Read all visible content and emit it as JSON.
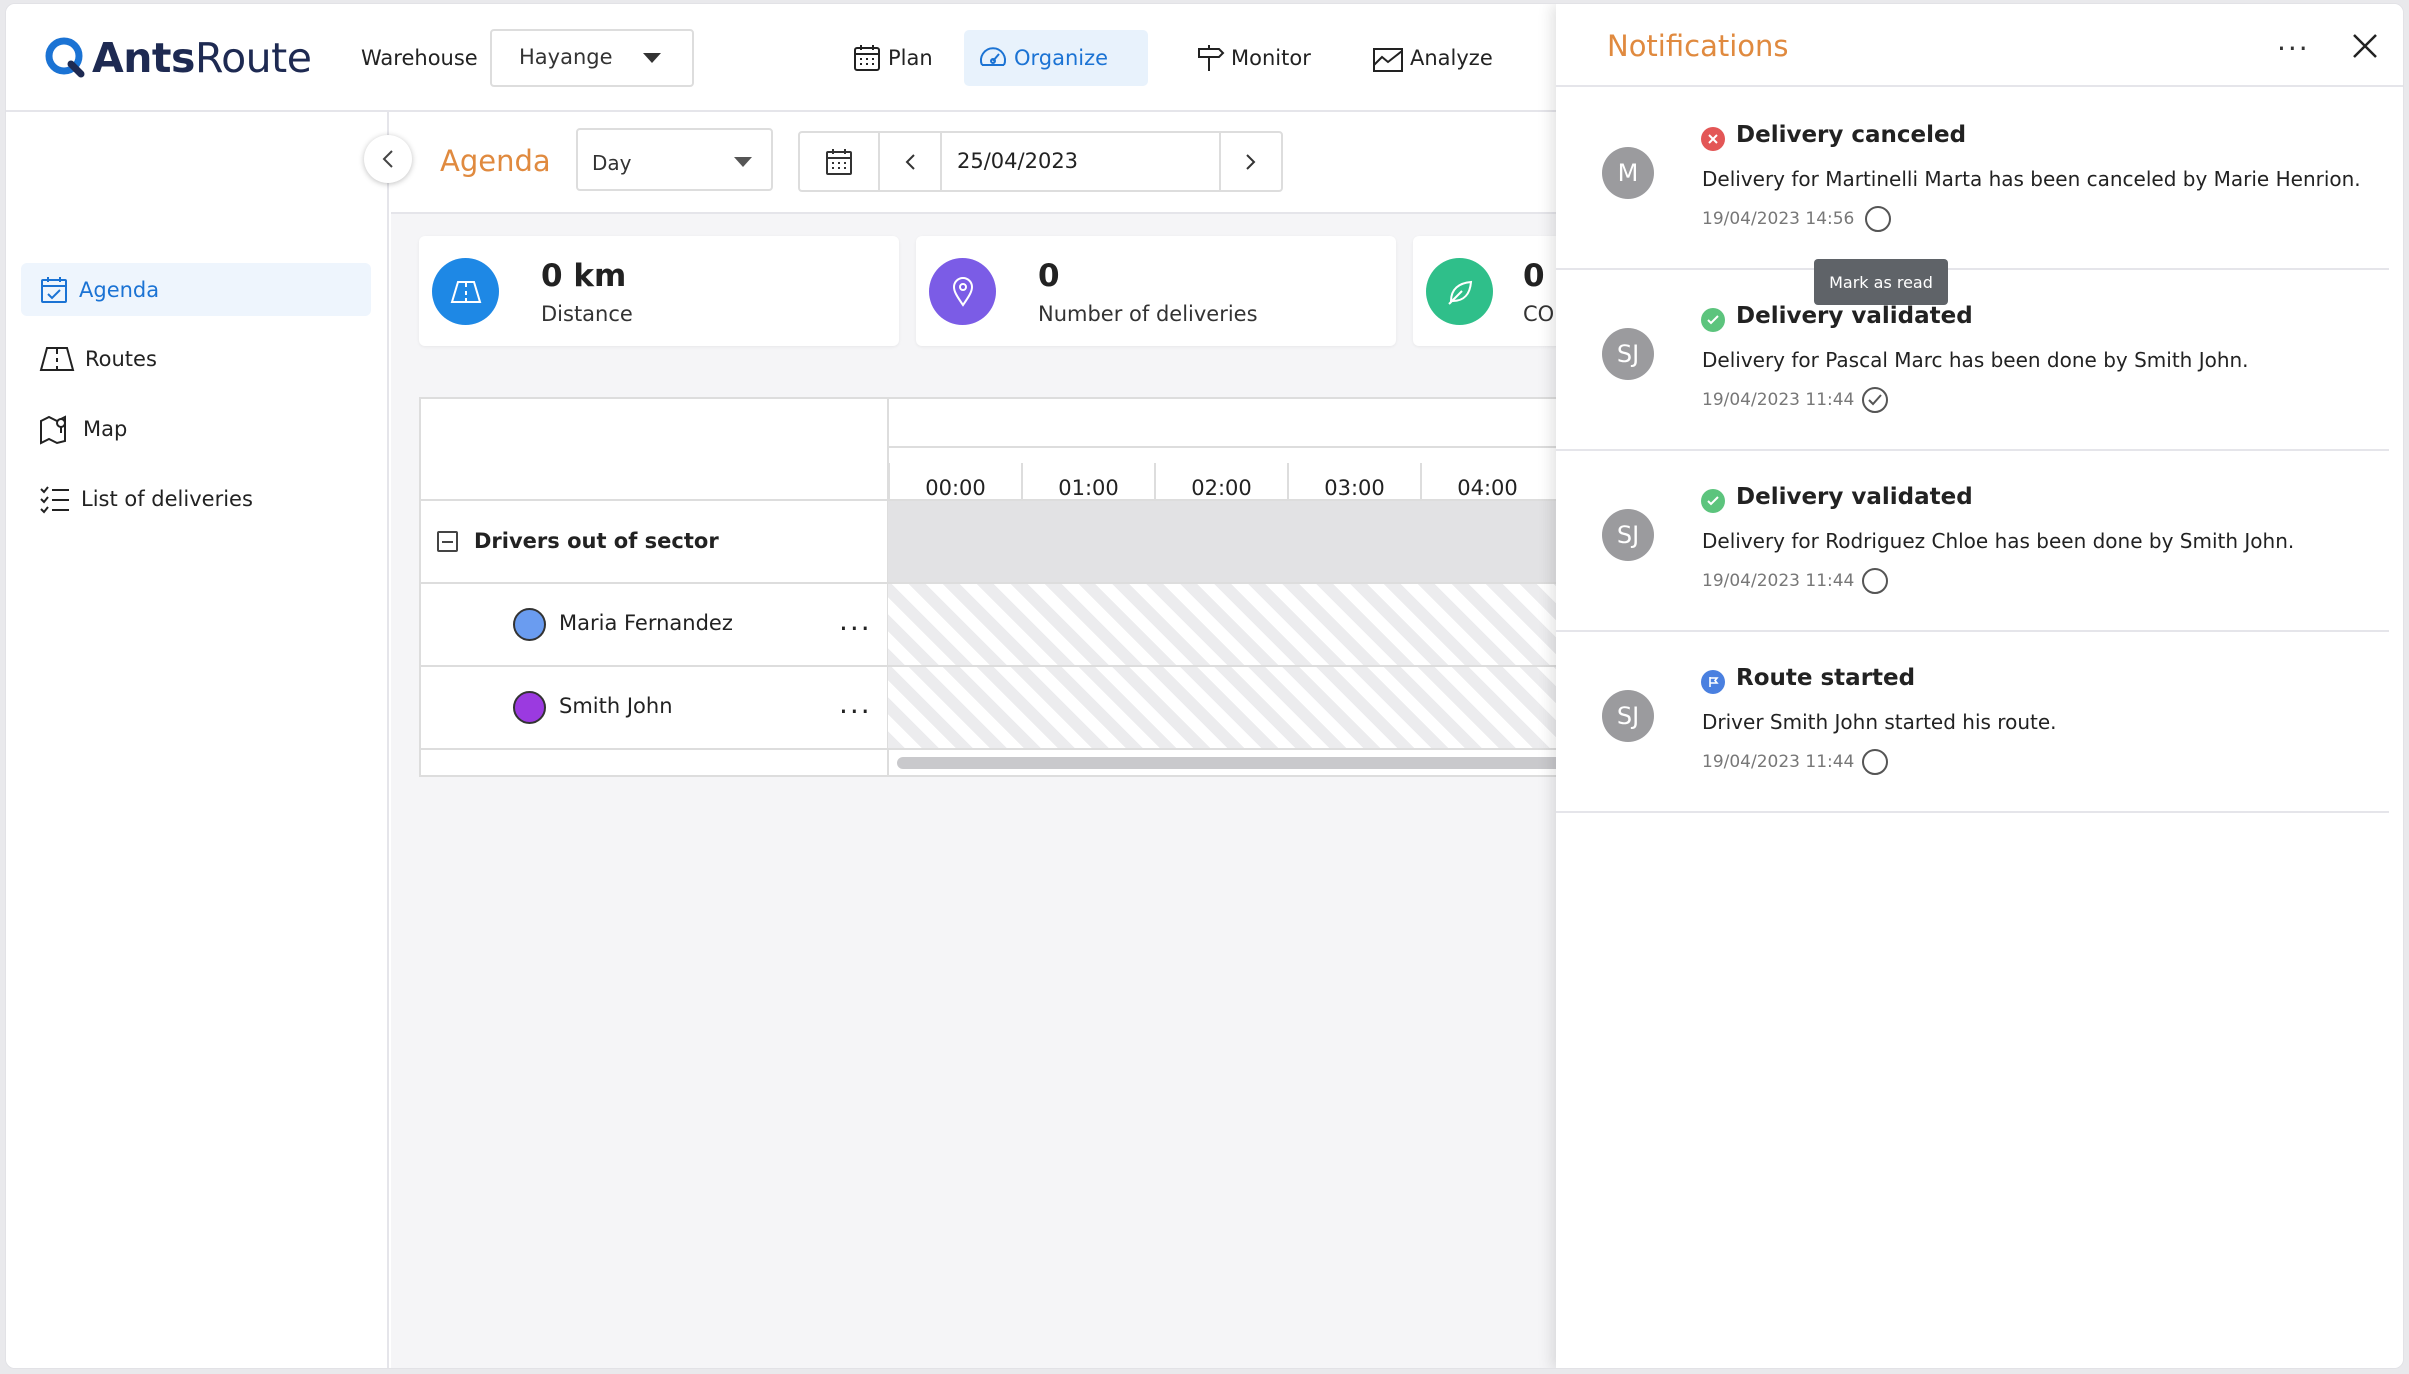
{
  "header": {
    "logo_bold": "Ants",
    "logo_rest": "Route",
    "warehouse_label": "Warehouse",
    "warehouse_value": "Hayange",
    "nav": [
      {
        "label": "Plan",
        "icon": "calendar-grid-icon"
      },
      {
        "label": "Organize",
        "icon": "speedometer-icon"
      },
      {
        "label": "Monitor",
        "icon": "signpost-icon"
      },
      {
        "label": "Analyze",
        "icon": "chart-area-icon"
      }
    ],
    "active_nav": "Organize",
    "accent_color": "#1b73d4"
  },
  "sidebar": {
    "items": [
      {
        "label": "Agenda",
        "icon": "calendar-check-icon",
        "active": true
      },
      {
        "label": "Routes",
        "icon": "map-fold-icon",
        "active": false
      },
      {
        "label": "Map",
        "icon": "map-pin-icon",
        "active": false
      },
      {
        "label": "List of deliveries",
        "icon": "checklist-icon",
        "active": false
      }
    ]
  },
  "agenda": {
    "title": "Agenda",
    "view": "Day",
    "date": "25/04/2023"
  },
  "stats": [
    {
      "value": "0 km",
      "label": "Distance",
      "icon": "road-icon",
      "color": "#1e88e5"
    },
    {
      "value": "0",
      "label": "Number of deliveries",
      "icon": "location-pin-icon",
      "color": "#7b5ce6"
    },
    {
      "value": "0",
      "label": "CO",
      "icon": "leaf-icon",
      "color": "#2fbf8a"
    }
  ],
  "schedule": {
    "hours": [
      "00:00",
      "01:00",
      "02:00",
      "03:00",
      "04:00"
    ],
    "group_label": "Drivers out of sector",
    "drivers": [
      {
        "name": "Maria Fernandez",
        "color": "#6a9cf0",
        "more": "..."
      },
      {
        "name": "Smith John",
        "color": "#9b3ae0",
        "more": "..."
      }
    ]
  },
  "notifications": {
    "title": "Notifications",
    "more": "...",
    "tooltip": "Mark as read",
    "items": [
      {
        "avatar": "M",
        "status": "canceled",
        "title": "Delivery canceled",
        "message": "Delivery for Martinelli Marta has been canceled by Marie Henrion.",
        "time": "19/04/2023 14:56",
        "read": false
      },
      {
        "avatar": "SJ",
        "status": "validated",
        "title": "Delivery validated",
        "message": "Delivery for Pascal Marc has been done by Smith John.",
        "time": "19/04/2023 11:44",
        "read": true
      },
      {
        "avatar": "SJ",
        "status": "validated",
        "title": "Delivery validated",
        "message": "Delivery for Rodriguez Chloe has been done by Smith John.",
        "time": "19/04/2023 11:44",
        "read": false
      },
      {
        "avatar": "SJ",
        "status": "route",
        "title": "Route started",
        "message": "Driver Smith John started his route.",
        "time": "19/04/2023 11:44",
        "read": false
      }
    ]
  }
}
